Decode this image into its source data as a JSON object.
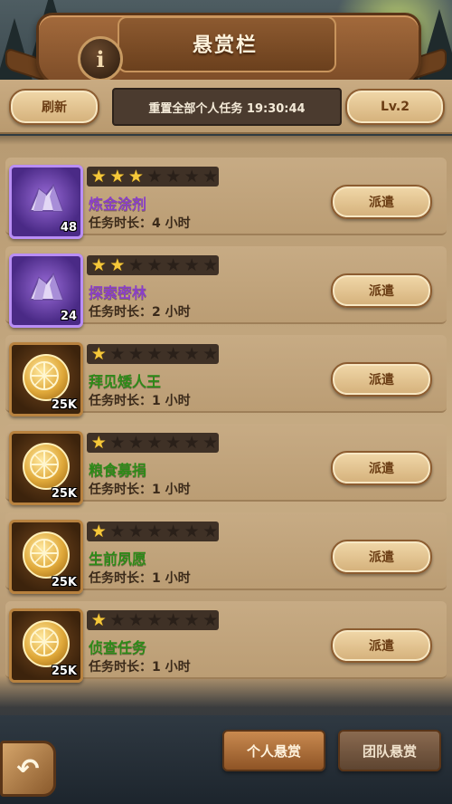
{
  "header": {
    "title": "悬赏栏",
    "info_icon": "info-icon"
  },
  "toolbar": {
    "refresh_label": "刷新",
    "reset_timer": "重置全部个人任务 19:30:44",
    "level_label": "Lv.2"
  },
  "quests": [
    {
      "name": "炼金涂剂",
      "name_color": "purple",
      "stars": 3,
      "max_stars": 7,
      "duration": "任务时长：4 小时",
      "reward_icon": "crystal-icon",
      "reward_qty": "48",
      "frame": "purple",
      "action": "派遣"
    },
    {
      "name": "探索密林",
      "name_color": "purple",
      "stars": 2,
      "max_stars": 7,
      "duration": "任务时长：2 小时",
      "reward_icon": "crystal-icon",
      "reward_qty": "24",
      "frame": "purple",
      "action": "派遣"
    },
    {
      "name": "拜见矮人王",
      "name_color": "green",
      "stars": 1,
      "max_stars": 7,
      "duration": "任务时长：1 小时",
      "reward_icon": "gold-coin-icon",
      "reward_qty": "25K",
      "frame": "gold",
      "action": "派遣"
    },
    {
      "name": "粮食募捐",
      "name_color": "green",
      "stars": 1,
      "max_stars": 7,
      "duration": "任务时长：1 小时",
      "reward_icon": "gold-coin-icon",
      "reward_qty": "25K",
      "frame": "gold",
      "action": "派遣"
    },
    {
      "name": "生前夙愿",
      "name_color": "green",
      "stars": 1,
      "max_stars": 7,
      "duration": "任务时长：1 小时",
      "reward_icon": "gold-coin-icon",
      "reward_qty": "25K",
      "frame": "gold",
      "action": "派遣"
    },
    {
      "name": "侦查任务",
      "name_color": "green",
      "stars": 1,
      "max_stars": 7,
      "duration": "任务时长：1 小时",
      "reward_icon": "gold-coin-icon",
      "reward_qty": "25K",
      "frame": "gold",
      "action": "派遣"
    }
  ],
  "bottom": {
    "back_icon": "back-arrow-icon",
    "tabs": [
      {
        "label": "个人悬赏",
        "active": true
      },
      {
        "label": "团队悬赏",
        "active": false
      }
    ]
  },
  "colors": {
    "star_on": "#f5c83a",
    "quest_purple": "#8a3fc8",
    "quest_green": "#2d8a18",
    "button_text": "#6b3d14"
  }
}
